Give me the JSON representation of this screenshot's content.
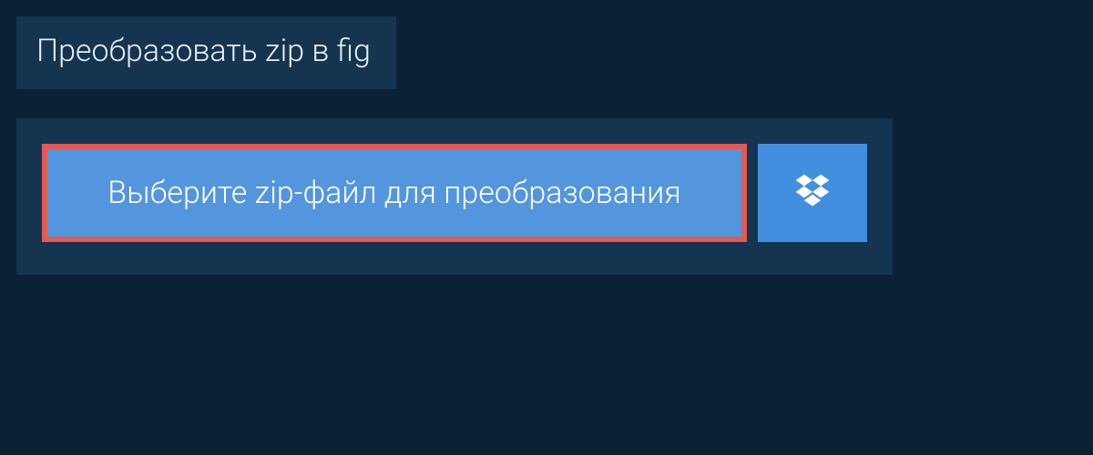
{
  "tab": {
    "title": "Преобразовать zip в fig"
  },
  "actions": {
    "select_file_label": "Выберите zip-файл для преобразования",
    "dropbox_icon": "dropbox-icon"
  },
  "colors": {
    "background": "#0b2135",
    "panel": "#143450",
    "primary_button": "#5396dd",
    "highlight_border": "#e35a53",
    "dropbox_button": "#418fde"
  }
}
